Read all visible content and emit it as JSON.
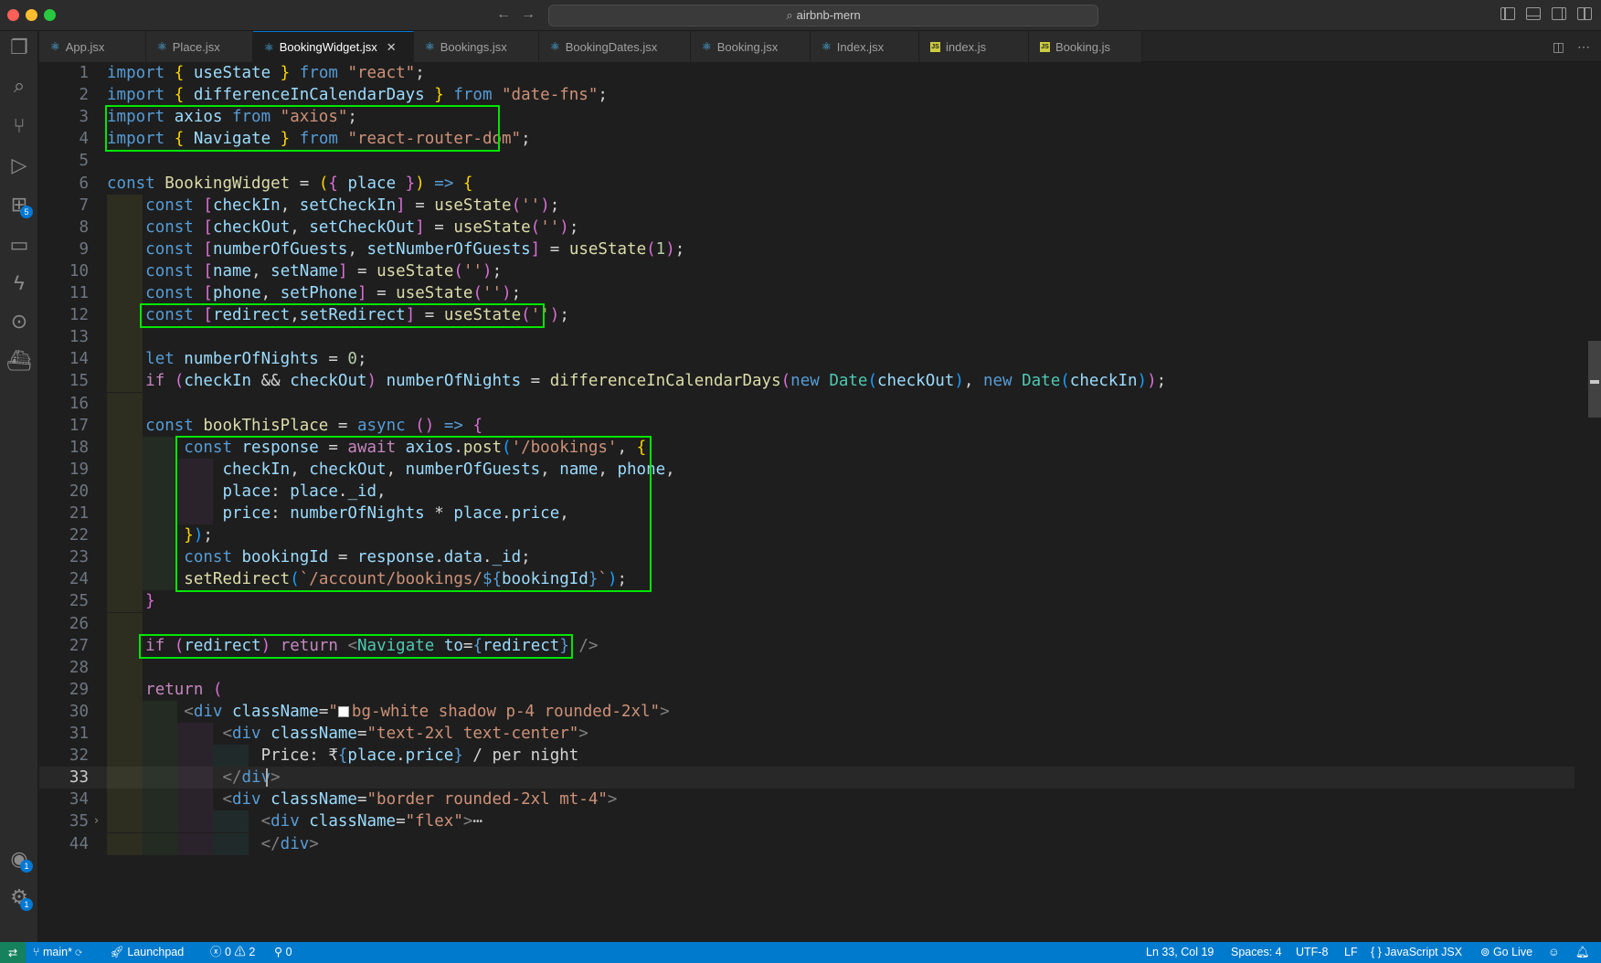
{
  "titlebar": {
    "search_text": "airbnb-mern"
  },
  "activity": {
    "extensions_badge": "5",
    "accounts_badge": "1",
    "settings_badge": "1"
  },
  "tabs": [
    {
      "label": "App.jsx",
      "icon": "react-icon"
    },
    {
      "label": "Place.jsx",
      "icon": "react-icon"
    },
    {
      "label": "BookingWidget.jsx",
      "icon": "react-icon",
      "active": true
    },
    {
      "label": "Bookings.jsx",
      "icon": "react-icon"
    },
    {
      "label": "BookingDates.jsx",
      "icon": "react-icon"
    },
    {
      "label": "Booking.jsx",
      "icon": "react-icon"
    },
    {
      "label": "Index.jsx",
      "icon": "react-icon"
    },
    {
      "label": "index.js",
      "icon": "js-icon"
    },
    {
      "label": "Booking.js",
      "icon": "js-icon"
    }
  ],
  "editor": {
    "current_line": 33,
    "line_numbers": [
      "1",
      "2",
      "3",
      "4",
      "5",
      "6",
      "7",
      "8",
      "9",
      "10",
      "11",
      "12",
      "13",
      "14",
      "15",
      "16",
      "17",
      "18",
      "19",
      "20",
      "21",
      "22",
      "23",
      "24",
      "25",
      "26",
      "27",
      "28",
      "29",
      "30",
      "31",
      "32",
      "33",
      "34",
      "35",
      "44"
    ],
    "lines": [
      [
        [
          "kw",
          "import"
        ],
        [
          "plain",
          " "
        ],
        [
          "br1",
          "{"
        ],
        [
          "var",
          " useState "
        ],
        [
          "br1",
          "}"
        ],
        [
          "kw",
          " from"
        ],
        [
          "str",
          " \"react\""
        ],
        [
          "plain",
          ";"
        ]
      ],
      [
        [
          "kw",
          "import"
        ],
        [
          "plain",
          " "
        ],
        [
          "br1",
          "{"
        ],
        [
          "var",
          " differenceInCalendarDays "
        ],
        [
          "br1",
          "}"
        ],
        [
          "kw",
          " from"
        ],
        [
          "str",
          " \"date-fns\""
        ],
        [
          "plain",
          ";"
        ]
      ],
      [
        [
          "kw",
          "import"
        ],
        [
          "var",
          " axios"
        ],
        [
          "kw",
          " from"
        ],
        [
          "str",
          " \"axios\""
        ],
        [
          "plain",
          ";"
        ]
      ],
      [
        [
          "kw",
          "import"
        ],
        [
          "plain",
          " "
        ],
        [
          "br1",
          "{"
        ],
        [
          "var",
          " Navigate "
        ],
        [
          "br1",
          "}"
        ],
        [
          "kw",
          " from"
        ],
        [
          "str",
          " \"react-router-dom\""
        ],
        [
          "plain",
          ";"
        ]
      ],
      [],
      [
        [
          "kw",
          "const"
        ],
        [
          "fn",
          " BookingWidget"
        ],
        [
          "plain",
          " = "
        ],
        [
          "br1",
          "("
        ],
        [
          "br2",
          "{"
        ],
        [
          "var",
          " place "
        ],
        [
          "br2",
          "}"
        ],
        [
          "br1",
          ")"
        ],
        [
          "kw",
          " =>"
        ],
        [
          "plain",
          " "
        ],
        [
          "br1",
          "{"
        ]
      ],
      [
        [
          "plain",
          "    "
        ],
        [
          "kw",
          "const"
        ],
        [
          "plain",
          " "
        ],
        [
          "br2",
          "["
        ],
        [
          "var",
          "checkIn"
        ],
        [
          "plain",
          ", "
        ],
        [
          "var",
          "setCheckIn"
        ],
        [
          "br2",
          "]"
        ],
        [
          "plain",
          " = "
        ],
        [
          "fn",
          "useState"
        ],
        [
          "br2",
          "("
        ],
        [
          "str",
          "''"
        ],
        [
          "br2",
          ")"
        ],
        [
          "plain",
          ";"
        ]
      ],
      [
        [
          "plain",
          "    "
        ],
        [
          "kw",
          "const"
        ],
        [
          "plain",
          " "
        ],
        [
          "br2",
          "["
        ],
        [
          "var",
          "checkOut"
        ],
        [
          "plain",
          ", "
        ],
        [
          "var",
          "setCheckOut"
        ],
        [
          "br2",
          "]"
        ],
        [
          "plain",
          " = "
        ],
        [
          "fn",
          "useState"
        ],
        [
          "br2",
          "("
        ],
        [
          "str",
          "''"
        ],
        [
          "br2",
          ")"
        ],
        [
          "plain",
          ";"
        ]
      ],
      [
        [
          "plain",
          "    "
        ],
        [
          "kw",
          "const"
        ],
        [
          "plain",
          " "
        ],
        [
          "br2",
          "["
        ],
        [
          "var",
          "numberOfGuests"
        ],
        [
          "plain",
          ", "
        ],
        [
          "var",
          "setNumberOfGuests"
        ],
        [
          "br2",
          "]"
        ],
        [
          "plain",
          " = "
        ],
        [
          "fn",
          "useState"
        ],
        [
          "br2",
          "("
        ],
        [
          "num",
          "1"
        ],
        [
          "br2",
          ")"
        ],
        [
          "plain",
          ";"
        ]
      ],
      [
        [
          "plain",
          "    "
        ],
        [
          "kw",
          "const"
        ],
        [
          "plain",
          " "
        ],
        [
          "br2",
          "["
        ],
        [
          "var",
          "name"
        ],
        [
          "plain",
          ", "
        ],
        [
          "var",
          "setName"
        ],
        [
          "br2",
          "]"
        ],
        [
          "plain",
          " = "
        ],
        [
          "fn",
          "useState"
        ],
        [
          "br2",
          "("
        ],
        [
          "str",
          "''"
        ],
        [
          "br2",
          ")"
        ],
        [
          "plain",
          ";"
        ]
      ],
      [
        [
          "plain",
          "    "
        ],
        [
          "kw",
          "const"
        ],
        [
          "plain",
          " "
        ],
        [
          "br2",
          "["
        ],
        [
          "var",
          "phone"
        ],
        [
          "plain",
          ", "
        ],
        [
          "var",
          "setPhone"
        ],
        [
          "br2",
          "]"
        ],
        [
          "plain",
          " = "
        ],
        [
          "fn",
          "useState"
        ],
        [
          "br2",
          "("
        ],
        [
          "str",
          "''"
        ],
        [
          "br2",
          ")"
        ],
        [
          "plain",
          ";"
        ]
      ],
      [
        [
          "plain",
          "    "
        ],
        [
          "kw",
          "const"
        ],
        [
          "plain",
          " "
        ],
        [
          "br2",
          "["
        ],
        [
          "var",
          "redirect"
        ],
        [
          "plain",
          ","
        ],
        [
          "var",
          "setRedirect"
        ],
        [
          "br2",
          "]"
        ],
        [
          "plain",
          " = "
        ],
        [
          "fn",
          "useState"
        ],
        [
          "br2",
          "("
        ],
        [
          "str",
          "''"
        ],
        [
          "br2",
          ")"
        ],
        [
          "plain",
          ";"
        ]
      ],
      [],
      [
        [
          "plain",
          "    "
        ],
        [
          "kw",
          "let"
        ],
        [
          "var",
          " numberOfNights"
        ],
        [
          "plain",
          " = "
        ],
        [
          "num",
          "0"
        ],
        [
          "plain",
          ";"
        ]
      ],
      [
        [
          "plain",
          "    "
        ],
        [
          "ctrl",
          "if"
        ],
        [
          "plain",
          " "
        ],
        [
          "br2",
          "("
        ],
        [
          "var",
          "checkIn"
        ],
        [
          "plain",
          " && "
        ],
        [
          "var",
          "checkOut"
        ],
        [
          "br2",
          ")"
        ],
        [
          "var",
          " numberOfNights"
        ],
        [
          "plain",
          " = "
        ],
        [
          "fn",
          "differenceInCalendarDays"
        ],
        [
          "br2",
          "("
        ],
        [
          "kw",
          "new"
        ],
        [
          "cls",
          " Date"
        ],
        [
          "br3",
          "("
        ],
        [
          "var",
          "checkOut"
        ],
        [
          "br3",
          ")"
        ],
        [
          "plain",
          ", "
        ],
        [
          "kw",
          "new"
        ],
        [
          "cls",
          " Date"
        ],
        [
          "br3",
          "("
        ],
        [
          "var",
          "checkIn"
        ],
        [
          "br3",
          ")"
        ],
        [
          "br2",
          ")"
        ],
        [
          "plain",
          ";"
        ]
      ],
      [],
      [
        [
          "plain",
          "    "
        ],
        [
          "kw",
          "const"
        ],
        [
          "fn",
          " bookThisPlace"
        ],
        [
          "plain",
          " = "
        ],
        [
          "kw",
          "async"
        ],
        [
          "plain",
          " "
        ],
        [
          "br2",
          "()"
        ],
        [
          "kw",
          " =>"
        ],
        [
          "plain",
          " "
        ],
        [
          "br2",
          "{"
        ]
      ],
      [
        [
          "plain",
          "        "
        ],
        [
          "kw",
          "const"
        ],
        [
          "var",
          " response"
        ],
        [
          "plain",
          " = "
        ],
        [
          "ctrl",
          "await"
        ],
        [
          "var",
          " axios"
        ],
        [
          "plain",
          "."
        ],
        [
          "fn",
          "post"
        ],
        [
          "br3",
          "("
        ],
        [
          "str",
          "'/bookings'"
        ],
        [
          "plain",
          ", "
        ],
        [
          "br1",
          "{"
        ]
      ],
      [
        [
          "plain",
          "            "
        ],
        [
          "var",
          "checkIn"
        ],
        [
          "plain",
          ", "
        ],
        [
          "var",
          "checkOut"
        ],
        [
          "plain",
          ", "
        ],
        [
          "var",
          "numberOfGuests"
        ],
        [
          "plain",
          ", "
        ],
        [
          "var",
          "name"
        ],
        [
          "plain",
          ", "
        ],
        [
          "var",
          "phone"
        ],
        [
          "plain",
          ","
        ]
      ],
      [
        [
          "plain",
          "            "
        ],
        [
          "var",
          "place"
        ],
        [
          "plain",
          ": "
        ],
        [
          "var",
          "place"
        ],
        [
          "plain",
          "."
        ],
        [
          "var",
          "_id"
        ],
        [
          "plain",
          ","
        ]
      ],
      [
        [
          "plain",
          "            "
        ],
        [
          "var",
          "price"
        ],
        [
          "plain",
          ": "
        ],
        [
          "var",
          "numberOfNights"
        ],
        [
          "plain",
          " * "
        ],
        [
          "var",
          "place"
        ],
        [
          "plain",
          "."
        ],
        [
          "var",
          "price"
        ],
        [
          "plain",
          ","
        ]
      ],
      [
        [
          "plain",
          "        "
        ],
        [
          "br1",
          "}"
        ],
        [
          "br3",
          ")"
        ],
        [
          "plain",
          ";"
        ]
      ],
      [
        [
          "plain",
          "        "
        ],
        [
          "kw",
          "const"
        ],
        [
          "var",
          " bookingId"
        ],
        [
          "plain",
          " = "
        ],
        [
          "var",
          "response"
        ],
        [
          "plain",
          "."
        ],
        [
          "var",
          "data"
        ],
        [
          "plain",
          "."
        ],
        [
          "var",
          "_id"
        ],
        [
          "plain",
          ";"
        ]
      ],
      [
        [
          "plain",
          "        "
        ],
        [
          "fn",
          "setRedirect"
        ],
        [
          "br3",
          "("
        ],
        [
          "str",
          "`/account/bookings/"
        ],
        [
          "kw",
          "${"
        ],
        [
          "var",
          "bookingId"
        ],
        [
          "kw",
          "}"
        ],
        [
          "str",
          "`"
        ],
        [
          "br3",
          ")"
        ],
        [
          "plain",
          ";"
        ]
      ],
      [
        [
          "plain",
          "    "
        ],
        [
          "br2",
          "}"
        ]
      ],
      [],
      [
        [
          "plain",
          "    "
        ],
        [
          "ctrl",
          "if"
        ],
        [
          "plain",
          " "
        ],
        [
          "br2",
          "("
        ],
        [
          "var",
          "redirect"
        ],
        [
          "br2",
          ")"
        ],
        [
          "ctrl",
          " return"
        ],
        [
          "tagc",
          " <"
        ],
        [
          "cls",
          "Navigate"
        ],
        [
          "attr",
          " to"
        ],
        [
          "plain",
          "="
        ],
        [
          "kw",
          "{"
        ],
        [
          "var",
          "redirect"
        ],
        [
          "kw",
          "}"
        ],
        [
          "tagc",
          " />"
        ]
      ],
      [],
      [
        [
          "plain",
          "    "
        ],
        [
          "ctrl",
          "return"
        ],
        [
          "plain",
          " "
        ],
        [
          "br2",
          "("
        ]
      ],
      [
        [
          "plain",
          "        "
        ],
        [
          "tagc",
          "<"
        ],
        [
          "tag",
          "div"
        ],
        [
          "attr",
          " className"
        ],
        [
          "plain",
          "="
        ],
        [
          "str",
          "\""
        ],
        [
          "swatch",
          ""
        ],
        [
          "str",
          "bg-white shadow p-4 rounded-2xl\""
        ],
        [
          "tagc",
          ">"
        ]
      ],
      [
        [
          "plain",
          "            "
        ],
        [
          "tagc",
          "<"
        ],
        [
          "tag",
          "div"
        ],
        [
          "attr",
          " className"
        ],
        [
          "plain",
          "="
        ],
        [
          "str",
          "\"text-2xl text-center\""
        ],
        [
          "tagc",
          ">"
        ]
      ],
      [
        [
          "plain",
          "                "
        ],
        [
          "plain",
          "Price: ₹"
        ],
        [
          "kw",
          "{"
        ],
        [
          "var",
          "place"
        ],
        [
          "plain",
          "."
        ],
        [
          "var",
          "price"
        ],
        [
          "kw",
          "}"
        ],
        [
          "plain",
          " / per night"
        ]
      ],
      [
        [
          "plain",
          "            "
        ],
        [
          "tagc",
          "</"
        ],
        [
          "tag",
          "div"
        ],
        [
          "tagc",
          ">"
        ]
      ],
      [
        [
          "plain",
          "            "
        ],
        [
          "tagc",
          "<"
        ],
        [
          "tag",
          "div"
        ],
        [
          "attr",
          " className"
        ],
        [
          "plain",
          "="
        ],
        [
          "str",
          "\"border rounded-2xl mt-4\""
        ],
        [
          "tagc",
          ">"
        ]
      ],
      [
        [
          "plain",
          "                "
        ],
        [
          "tagc",
          "<"
        ],
        [
          "tag",
          "div"
        ],
        [
          "attr",
          " className"
        ],
        [
          "plain",
          "="
        ],
        [
          "str",
          "\"flex\""
        ],
        [
          "tagc",
          ">"
        ],
        [
          "plain",
          "⋯"
        ]
      ],
      [
        [
          "plain",
          "                "
        ],
        [
          "tagc",
          "</"
        ],
        [
          "tag",
          "div"
        ],
        [
          "tagc",
          ">"
        ]
      ]
    ],
    "indent_levels": [
      0,
      0,
      0,
      0,
      0,
      0,
      1,
      1,
      1,
      1,
      1,
      1,
      1,
      1,
      1,
      1,
      1,
      2,
      3,
      3,
      3,
      2,
      2,
      2,
      1,
      1,
      1,
      1,
      1,
      2,
      3,
      4,
      3,
      3,
      4,
      4
    ]
  },
  "statusbar": {
    "branch": "main*",
    "launchpad": "Launchpad",
    "errors": "0",
    "warnings": "2",
    "ports": "0",
    "position": "Ln 33, Col 19",
    "spaces": "Spaces: 4",
    "encoding": "UTF-8",
    "eol": "LF",
    "language": "JavaScript JSX",
    "golive": "Go Live"
  }
}
